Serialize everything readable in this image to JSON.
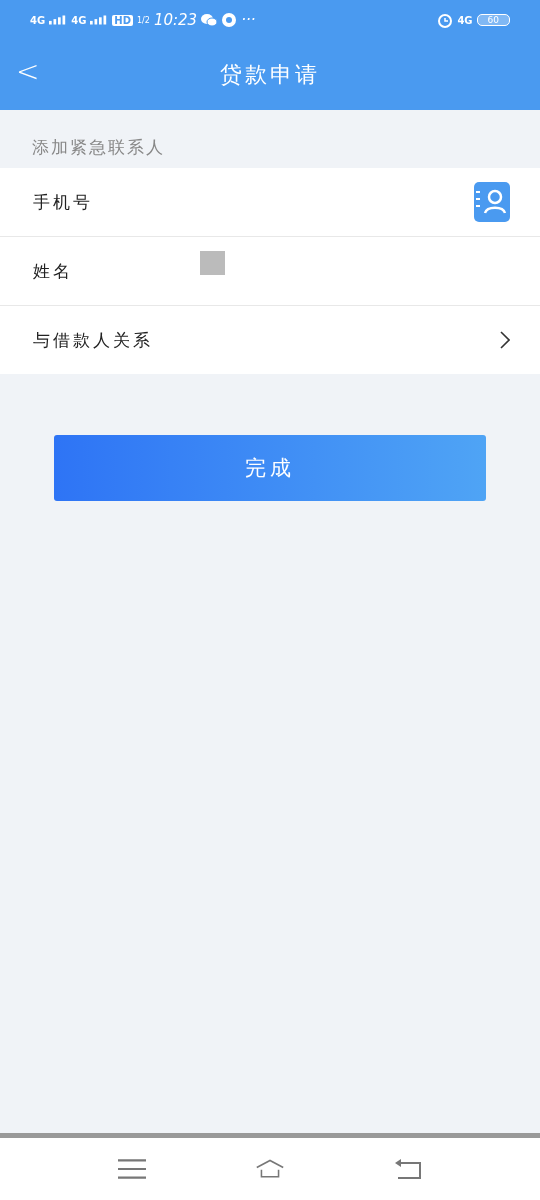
{
  "status_bar": {
    "signal_1": "4G",
    "signal_2": "4G",
    "hd": "HD",
    "sim": "1/2",
    "time": "10:23",
    "dots": "···",
    "network": "4G",
    "battery": "60"
  },
  "header": {
    "back": "<",
    "title": "贷款申请"
  },
  "section": {
    "title": "添加紧急联系人"
  },
  "fields": [
    {
      "label": "手机号",
      "kind": "contacts"
    },
    {
      "label": "姓名",
      "kind": "redacted"
    },
    {
      "label": "与借款人关系",
      "kind": "select"
    }
  ],
  "submit": {
    "label": "完成"
  }
}
